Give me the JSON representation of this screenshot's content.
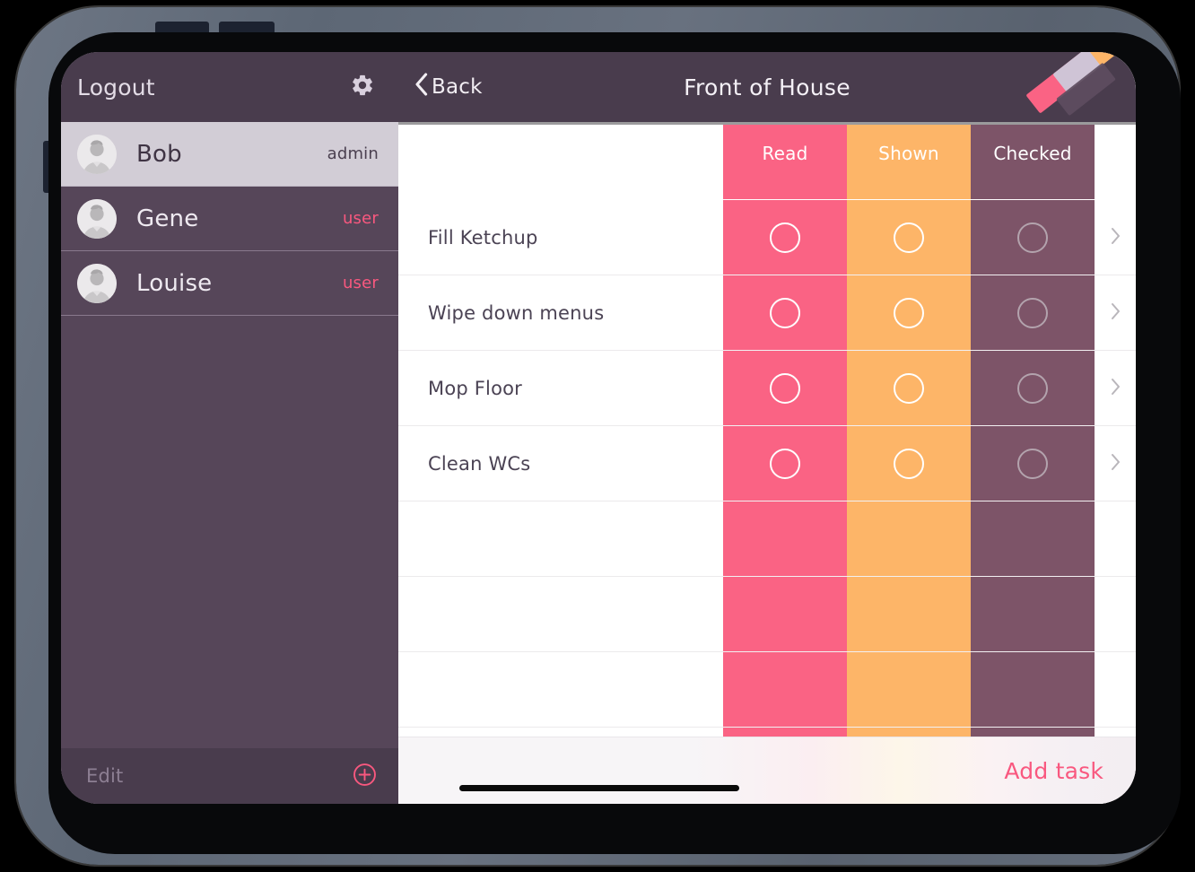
{
  "sidebar": {
    "header": {
      "logout_label": "Logout",
      "settings_icon": "gear-icon"
    },
    "users": [
      {
        "name": "Bob",
        "role": "admin",
        "selected": true,
        "avatar_icon": "person-avatar-icon"
      },
      {
        "name": "Gene",
        "role": "user",
        "selected": false,
        "avatar_icon": "person-avatar-icon"
      },
      {
        "name": "Louise",
        "role": "user",
        "selected": false,
        "avatar_icon": "person-avatar-icon"
      }
    ],
    "footer": {
      "edit_label": "Edit",
      "add_icon": "plus-circle-icon"
    }
  },
  "main": {
    "header": {
      "back_label": "Back",
      "back_icon": "chevron-left-icon",
      "title": "Front of House",
      "logo_icon": "brand-parallelogram-logo"
    },
    "table": {
      "columns": [
        {
          "key": "task",
          "label": "",
          "color": "#ffffff"
        },
        {
          "key": "read",
          "label": "Read",
          "color": "#fa6384"
        },
        {
          "key": "shown",
          "label": "Shown",
          "color": "#fdb568"
        },
        {
          "key": "checked",
          "label": "Checked",
          "color": "#7d5468"
        }
      ],
      "rows": [
        {
          "task": "Fill Ketchup",
          "read": "unchecked",
          "shown": "unchecked",
          "checked": "unchecked",
          "chevron": true
        },
        {
          "task": "Wipe down menus",
          "read": "unchecked",
          "shown": "unchecked",
          "checked": "unchecked",
          "chevron": true
        },
        {
          "task": "Mop Floor",
          "read": "unchecked",
          "shown": "unchecked",
          "checked": "unchecked",
          "chevron": true
        },
        {
          "task": "Clean WCs",
          "read": "unchecked",
          "shown": "unchecked",
          "checked": "unchecked",
          "chevron": true
        },
        {
          "task": "",
          "read": "",
          "shown": "",
          "checked": "",
          "chevron": false
        },
        {
          "task": "",
          "read": "",
          "shown": "",
          "checked": "",
          "chevron": false
        },
        {
          "task": "",
          "read": "",
          "shown": "",
          "checked": "",
          "chevron": false
        },
        {
          "task": "",
          "read": "",
          "shown": "",
          "checked": "",
          "chevron": false
        }
      ]
    },
    "bottom_bar": {
      "add_task_label": "Add task"
    }
  },
  "colors": {
    "accent_pink": "#f9587f",
    "column_read": "#fa6384",
    "column_shown": "#fdb568",
    "column_checked": "#7d5468",
    "sidebar_bg": "#564659",
    "header_bg": "#493c4d",
    "selected_row_bg": "#d2cdd6"
  }
}
